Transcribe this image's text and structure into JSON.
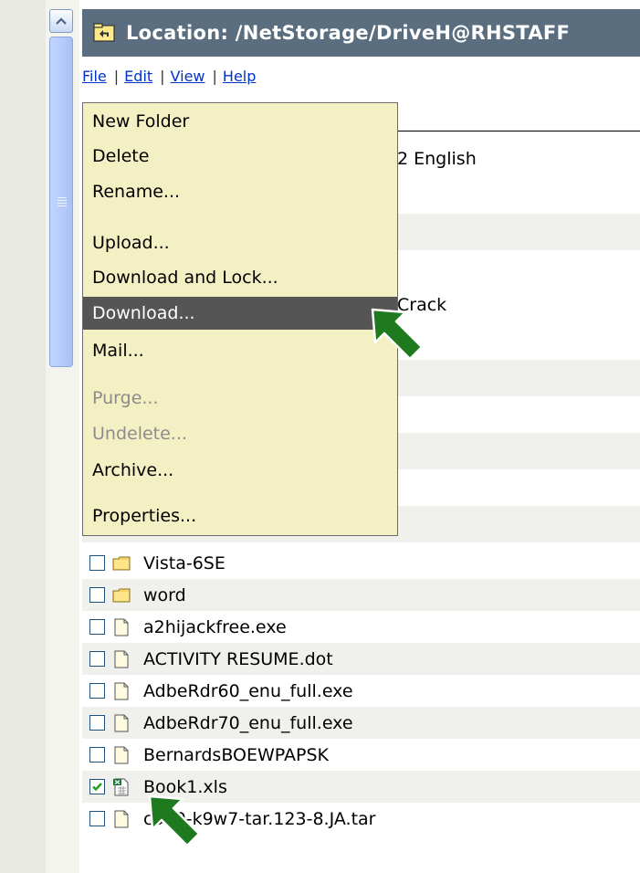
{
  "header": {
    "title": "Location: /NetStorage/DriveH@RHSTAFF"
  },
  "menubar": {
    "file": "File",
    "edit": "Edit",
    "view": "View",
    "help": "Help",
    "separator": "|"
  },
  "file_menu": {
    "items": [
      {
        "label": "New Folder"
      },
      {
        "label": "Delete"
      },
      {
        "label": "Rename..."
      },
      {
        "label": "Upload..."
      },
      {
        "label": "Download and Lock..."
      },
      {
        "label": "Download..."
      },
      {
        "label": "Mail..."
      },
      {
        "label": "Purge..."
      },
      {
        "label": "Undelete..."
      },
      {
        "label": "Archive..."
      },
      {
        "label": "Properties..."
      }
    ],
    "highlighted": "Download...",
    "disabled": [
      "Purge...",
      "Undelete..."
    ]
  },
  "partial_rows": [
    "2 English",
    "Crack"
  ],
  "files": [
    {
      "name": "Vista-6SE",
      "type": "folder",
      "checked": false
    },
    {
      "name": "word",
      "type": "folder",
      "checked": false
    },
    {
      "name": "a2hijackfree.exe",
      "type": "file",
      "checked": false
    },
    {
      "name": "ACTIVITY RESUME.dot",
      "type": "file",
      "checked": false
    },
    {
      "name": "AdbeRdr60_enu_full.exe",
      "type": "file",
      "checked": false
    },
    {
      "name": "AdbeRdr70_enu_full.exe",
      "type": "file",
      "checked": false
    },
    {
      "name": "BernardsBOEWPAPSK",
      "type": "file",
      "checked": false
    },
    {
      "name": "Book1.xls",
      "type": "excel",
      "checked": true
    },
    {
      "name": "c350-k9w7-tar.123-8.JA.tar",
      "type": "file",
      "checked": false
    }
  ],
  "colors": {
    "header_bg": "#5a6e7f",
    "menu_bg": "#f3f0c3",
    "highlight_bg": "#555555",
    "arrow": "#1f7a1f",
    "link": "#0033cc"
  },
  "icons": {
    "header": "folder-up-icon",
    "folder": "folder-icon",
    "file": "document-icon",
    "excel": "excel-file-icon",
    "pointer": "arrow-pointer-icon"
  }
}
